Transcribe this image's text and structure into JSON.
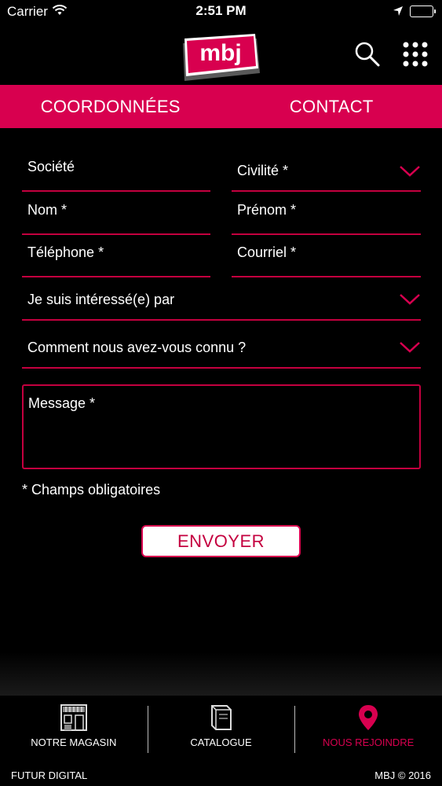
{
  "status_bar": {
    "carrier": "Carrier",
    "time": "2:51 PM",
    "icons": [
      "wifi-icon",
      "location-arrow-icon",
      "battery-icon"
    ]
  },
  "header": {
    "logo_text": "mbj",
    "icons": [
      "search-icon",
      "grid-menu-icon"
    ]
  },
  "tabs": [
    {
      "label": "COORDONNÉES"
    },
    {
      "label": "CONTACT"
    }
  ],
  "form": {
    "societe": "Société",
    "civilite": "Civilité *",
    "nom": "Nom *",
    "prenom": "Prénom *",
    "telephone": "Téléphone *",
    "courriel": "Courriel *",
    "interesse": "Je suis intéressé(e) par",
    "connu": "Comment nous avez-vous connu ?",
    "message": "Message *",
    "required_note": "* Champs obligatoires",
    "send_label": "ENVOYER"
  },
  "bottom_nav": {
    "items": [
      {
        "label": "NOTRE MAGASIN",
        "icon": "store-icon"
      },
      {
        "label": "CATALOGUE",
        "icon": "catalogue-icon"
      },
      {
        "label": "NOUS REJOINDRE",
        "icon": "map-pin-icon"
      }
    ]
  },
  "footer": {
    "left": "FUTUR DIGITAL",
    "right": "MBJ © 2016"
  },
  "colors": {
    "accent": "#d8004f",
    "background": "#000000",
    "text": "#ffffff"
  }
}
